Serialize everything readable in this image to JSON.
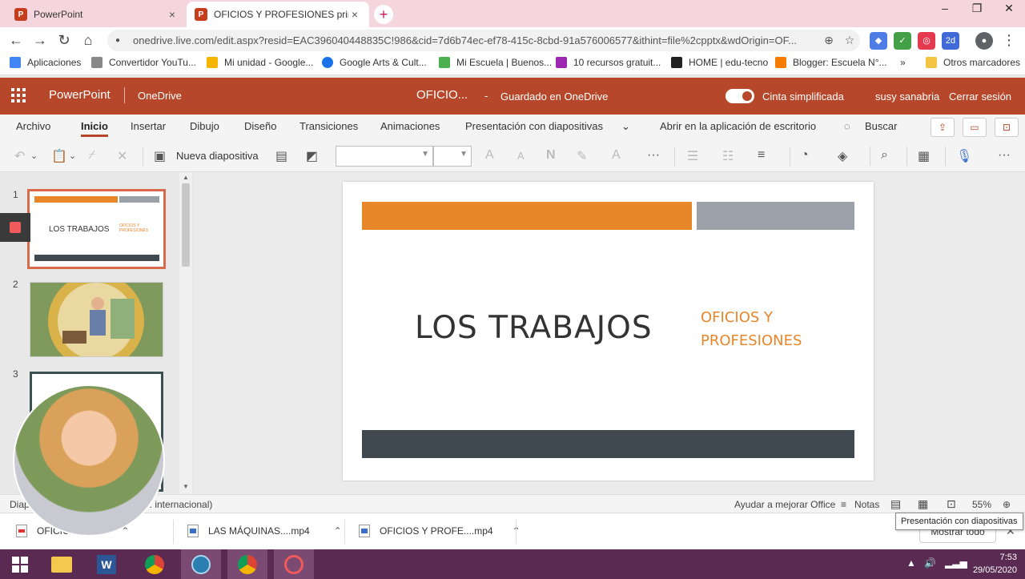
{
  "browser": {
    "tabs": [
      {
        "title": "PowerPoint",
        "active": false
      },
      {
        "title": "OFICIOS Y PROFESIONES primer",
        "active": true
      }
    ],
    "url": "onedrive.live.com/edit.aspx?resid=EAC396040448835C!986&cid=7d6b74ec-ef78-415c-8cbd-91a576006577&ithint=file%2cpptx&wdOrigin=OF...",
    "bookmarks": [
      "Aplicaciones",
      "Convertidor YouTu...",
      "Mi unidad - Google...",
      "Google Arts & Cult...",
      "Mi Escuela | Buenos...",
      "10 recursos gratuit...",
      "HOME | edu-tecno",
      "Blogger: Escuela N°...",
      "Otros marcadores"
    ]
  },
  "appbar": {
    "app_name": "PowerPoint",
    "location": "OneDrive",
    "doc_title": "OFICIO...",
    "separator": "-",
    "save_status": "Guardado en OneDrive",
    "simplified_ribbon": "Cinta simplificada",
    "user": "susy sanabria",
    "sign_out": "Cerrar sesión"
  },
  "ribbon": {
    "tabs": [
      "Archivo",
      "Inicio",
      "Insertar",
      "Dibujo",
      "Diseño",
      "Transiciones",
      "Animaciones",
      "Presentación con diapositivas"
    ],
    "active_tab": "Inicio",
    "open_desktop": "Abrir en la aplicación de escritorio",
    "search": "Buscar",
    "new_slide": "Nueva diapositiva"
  },
  "thumbnails": {
    "numbers": [
      "1",
      "2",
      "3"
    ],
    "slide1_title": "LOS TRABAJOS",
    "slide1_sub": "OFICIOS Y PROFESIONES"
  },
  "slide": {
    "title": "LOS TRABAJOS",
    "subtitle_line1": "OFICIOS Y",
    "subtitle_line2": "PROFESIONES",
    "colors": {
      "orange": "#e8862a",
      "gray": "#9aa1a8",
      "dark": "#40494f"
    }
  },
  "statusbar": {
    "left_a": "Diap",
    "left_b": "b. internacional)",
    "help": "Ayudar a mejorar Office",
    "notes": "Notas",
    "zoom": "55%"
  },
  "tooltip": "Presentación con diapositivas",
  "downloads": {
    "items": [
      "OFICIOS ...pdf",
      "LAS MÁQUINAS....mp4",
      "OFICIOS Y PROFE....mp4"
    ],
    "show_all": "Mostrar todo"
  },
  "clock": {
    "time": "7:53",
    "date": "29/05/2020"
  }
}
